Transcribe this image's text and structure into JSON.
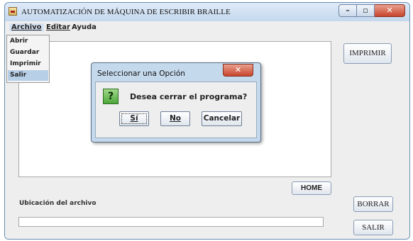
{
  "window": {
    "title": "AUTOMATIZACIÓN DE MÁQUINA DE ESCRIBIR BRAILLE",
    "icon": "java-app-icon",
    "controls": [
      "minimize-icon",
      "maximize-icon",
      "close-icon"
    ]
  },
  "menubar": {
    "items": [
      "Archivo",
      "Editar",
      "Ayuda"
    ],
    "active": "Archivo"
  },
  "archivo_menu": {
    "items": [
      "Abrir",
      "Guardar",
      "Imprimir",
      "Salir"
    ],
    "highlighted": "Salir"
  },
  "main": {
    "file_location_label": "Ubicación del archivo",
    "file_location_value": "",
    "buttons": {
      "imprimir": "IMPRIMIR",
      "home": "HOME",
      "borrar": "BORRAR",
      "salir": "SALIR"
    }
  },
  "dialog": {
    "title": "Seleccionar una Opción",
    "icon": "question-icon",
    "icon_glyph": "?",
    "message": "Desea cerrar el programa?",
    "buttons": {
      "yes": "Sí",
      "no": "No",
      "cancel": "Cancelar"
    }
  }
}
